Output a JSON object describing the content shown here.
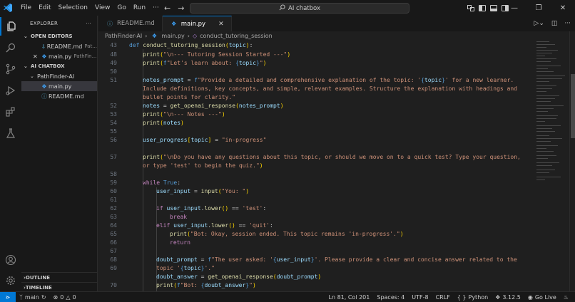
{
  "titlebar": {
    "menus": [
      "File",
      "Edit",
      "Selection",
      "View",
      "Go",
      "Run",
      "···"
    ],
    "search_text": "AI chatbox"
  },
  "sidebar": {
    "header": "EXPLORER",
    "open_editors_label": "OPEN EDITORS",
    "open_editors": [
      {
        "name": "README.md",
        "path": "Pat..."
      },
      {
        "name": "main.py",
        "path": "PathFin..."
      }
    ],
    "workspace_label": "AI CHATBOX",
    "folder": "PathFinder-AI",
    "files": [
      "main.py",
      "README.md"
    ],
    "outline_label": "OUTLINE",
    "timeline_label": "TIMELINE"
  },
  "tabs": [
    {
      "label": "README.md"
    },
    {
      "label": "main.py"
    }
  ],
  "breadcrumb": [
    "PathFinder-AI",
    "main.py",
    "conduct_tutoring_session"
  ],
  "editor": {
    "gutter": [
      "43",
      "48",
      "49",
      "50",
      "51",
      "",
      "",
      "52",
      "53",
      "54",
      "55",
      "56",
      "57",
      "",
      "58",
      "59",
      "60",
      "61",
      "62",
      "63",
      "64",
      "65",
      "66",
      "67",
      "68",
      "69",
      "",
      "70",
      "71"
    ]
  },
  "statusbar": {
    "branch": "main",
    "problems": "0",
    "warnings": "0",
    "position": "Ln 81, Col 201",
    "spaces": "Spaces: 4",
    "encoding": "UTF-8",
    "eol": "CRLF",
    "language": "Python",
    "python_version": "3.12.5",
    "golive": "Go Live"
  },
  "colors": {
    "accent": "#0078d4",
    "keyword": "#569cd6",
    "control": "#c586c0",
    "function": "#dcdcaa",
    "string": "#ce9178",
    "variable": "#9cdcfe"
  }
}
